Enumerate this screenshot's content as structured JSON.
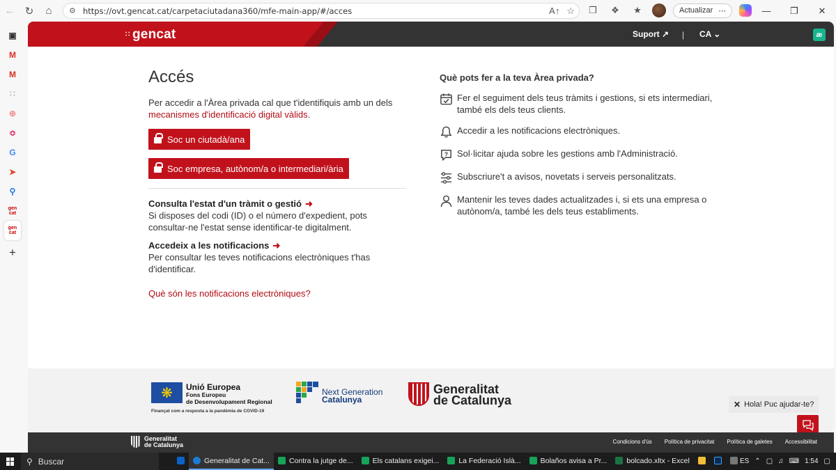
{
  "browser": {
    "url": "https://ovt.gencat.cat/carpetaciutadana360/mfe-main-app/#/acces",
    "update_label": "Actualizar"
  },
  "header": {
    "logo": "gencat",
    "support": "Suport",
    "language": "CA",
    "app_badge": "æ"
  },
  "access": {
    "title": "Accés",
    "intro": "Per accedir a l'Àrea privada cal que t'identifiquis amb un dels",
    "intro_link": "mecanismes d'identificació digital vàlids",
    "intro_end": ".",
    "btn_citizen": "Soc un ciutadà/ana",
    "btn_business": "Soc empresa, autònom/a o intermediari/ària",
    "consult_title": "Consulta l'estat d'un tràmit o gestió",
    "consult_desc": "Si disposes del codi (ID) o el número d'expedient, pots consultar-ne l'estat sense identificar-te digitalment.",
    "notif_title": "Accedeix a les notificacions",
    "notif_desc": "Per consultar les teves notificacions electròniques t'has d'identificar.",
    "notif_link": "Què són les notificacions electròniques?"
  },
  "features": {
    "title": "Què pots fer a la teva Àrea privada?",
    "items": [
      {
        "icon": "calendar-check-icon",
        "text": "Fer el seguiment dels teus tràmits i gestions, si ets intermediari, també els dels teus clients."
      },
      {
        "icon": "bell-icon",
        "text": "Accedir a les notificacions electròniques."
      },
      {
        "icon": "question-icon",
        "text": "Sol·licitar ajuda sobre les gestions amb l'Administració."
      },
      {
        "icon": "sliders-icon",
        "text": "Subscriure't a avisos, novetats i serveis personalitzats."
      },
      {
        "icon": "user-icon",
        "text": "Mantenir les teves dades actualitzades i, si ets una empresa o autònom/a, també les dels teus establiments."
      }
    ]
  },
  "footer_logos": {
    "eu_title": "Unió Europea",
    "eu_sub1": "Fons Europeu",
    "eu_sub2": "de Desenvolupament Regional",
    "eu_note": "Finançat com a resposta a la pandèmia de COVID-19",
    "ng_line1": "Next Generation",
    "ng_line2": "Catalunya",
    "gc_line1": "Generalitat",
    "gc_line2": "de Catalunya"
  },
  "chat": {
    "bubble": "Hola! Puc ajudar-te?"
  },
  "footer_bar": {
    "logo_line1": "Generalitat",
    "logo_line2": "de Catalunya",
    "links": [
      "Condicions d'ús",
      "Política de privacitat",
      "Política de galetes",
      "Accessibilitat"
    ]
  },
  "taskbar": {
    "search": "Buscar",
    "tasks": [
      {
        "label": "Generalitat de Cat...",
        "color": "#1f7ad6",
        "active": true
      },
      {
        "label": "Contra la jutge de...",
        "color": "#18a35a"
      },
      {
        "label": "Els catalans exigei...",
        "color": "#18a35a"
      },
      {
        "label": "La Federació Islà...",
        "color": "#18a35a"
      },
      {
        "label": "Bolaños avisa a Pr...",
        "color": "#18a35a"
      },
      {
        "label": "bolcado.xltx - Excel",
        "color": "#1d7245"
      }
    ],
    "lang": "ES",
    "time": "1:54"
  },
  "colors": {
    "accent": "#c1121c",
    "header_dark": "#333333"
  }
}
